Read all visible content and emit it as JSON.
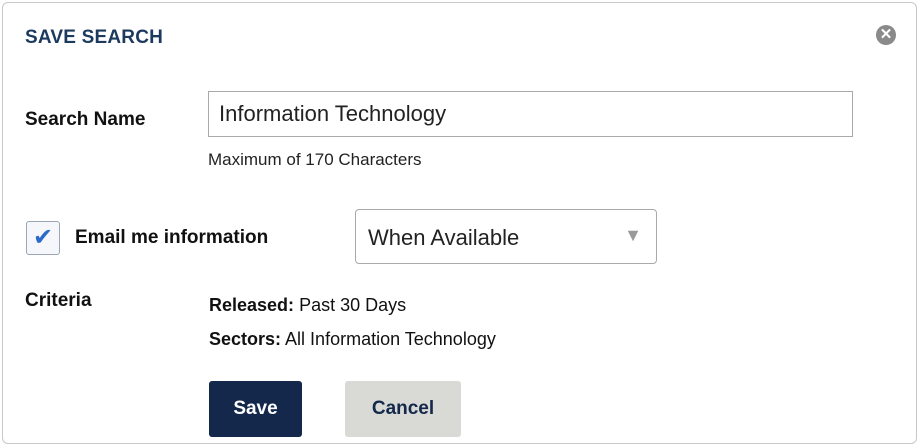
{
  "dialog": {
    "title": "SAVE SEARCH",
    "close_glyph": "✕",
    "close_icon": "close-circle-icon"
  },
  "search_name": {
    "label": "Search Name",
    "value": "Information Technology",
    "hint": "Maximum of 170 Characters"
  },
  "email": {
    "checked": true,
    "check_glyph": "✔",
    "label": "Email me information",
    "frequency_selected": "When Available",
    "arrow_glyph": "▼"
  },
  "criteria": {
    "label": "Criteria",
    "items": [
      {
        "key": "Released:",
        "value": "Past 30 Days"
      },
      {
        "key": "Sectors:",
        "value": "All Information Technology"
      }
    ]
  },
  "buttons": {
    "save": "Save",
    "cancel": "Cancel"
  },
  "colors": {
    "title": "#1c3a5e",
    "save_bg": "#13284a",
    "cancel_bg": "#d9d9d6",
    "check": "#2a6bc8"
  }
}
